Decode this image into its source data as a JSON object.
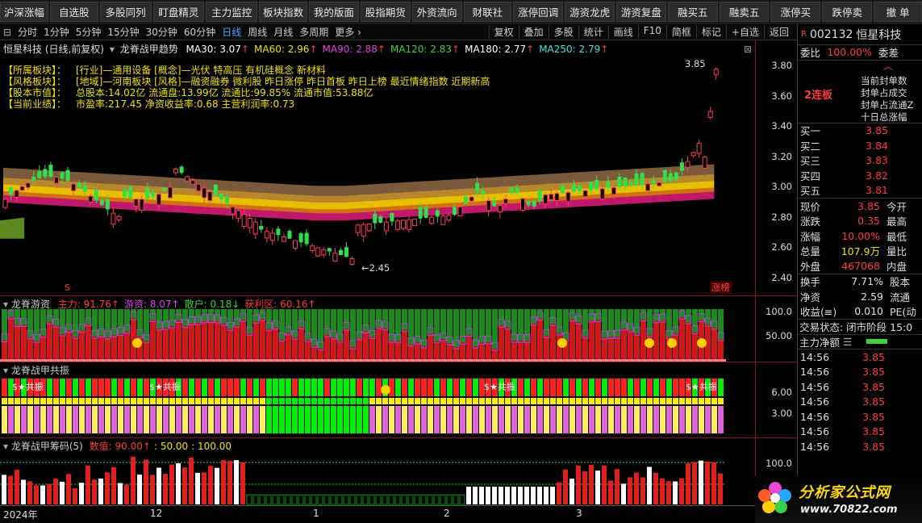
{
  "topbar": {
    "buttons": [
      "沪深涨幅",
      "自选股",
      "多股同列",
      "盯盘精灵",
      "主力监控",
      "板块指数",
      "我的版面",
      "股指期货",
      "外资流向",
      "财联社",
      "涨停回调",
      "游资龙虎",
      "游资复盘",
      "融买五",
      "融卖五",
      "涨停买",
      "跌停卖",
      "撤 单"
    ]
  },
  "periodbar": {
    "items": [
      "分时",
      "1分钟",
      "5分钟",
      "15分钟",
      "30分钟",
      "60分钟",
      "日线",
      "周线",
      "月线",
      "多周期",
      "更多 ›"
    ],
    "active": "日线",
    "right": [
      "复权",
      "叠加",
      "多股",
      "统计",
      "画线",
      "F10",
      "简框",
      "标记",
      "+自选",
      "返回"
    ]
  },
  "main": {
    "title": "恒星科技 (日线,前复权)",
    "indicator": "龙脊战甲趋势",
    "ma": [
      {
        "label": "MA30: 3.07",
        "color": "#ffffff"
      },
      {
        "label": "MA60: 2.96",
        "color": "#f0e000"
      },
      {
        "label": "MA90: 2.88",
        "color": "#e040e0"
      },
      {
        "label": "MA120: 2.83",
        "color": "#3cd23c"
      },
      {
        "label": "MA180: 2.77",
        "color": "#ffffff"
      },
      {
        "label": "MA250: 2.79",
        "color": "#40e0e0"
      }
    ],
    "info": [
      {
        "k": "【所属板块】：",
        "v": "[行业]—通用设备 [概念]—光伏 特高压 有机硅概念 新材料"
      },
      {
        "k": "【风格板块】：",
        "v": "[地域]—河南板块 [风格]—融资融券 微利股 昨日涨停 昨日首板 昨日上榜 最近情绪指数 近期新高"
      },
      {
        "k": "【股本市值】：",
        "v": "总股本:14.02亿 流通盘:13.99亿 流通比:99.85% 流通市值:53.88亿"
      },
      {
        "k": "【当前业绩】：",
        "v": "市盈率:217.45 净资收益率:0.68 主营利润率:0.73"
      }
    ],
    "high_label": "3.85",
    "low_label": "←2.45",
    "badge": "涨榜",
    "axis": [
      "3.80",
      "3.60",
      "3.40",
      "3.20",
      "3.00",
      "2.80",
      "2.60",
      "2.40"
    ]
  },
  "panel1": {
    "title": "龙脊游资",
    "vals": [
      {
        "label": "主力: 91.76↑",
        "color": "#ff3b3b"
      },
      {
        "label": "游资: 8.07↑",
        "color": "#e040e0"
      },
      {
        "label": "散户: 0.18↓",
        "color": "#3cd23c"
      },
      {
        "label": "获利区: 60.16↑",
        "color": "#ff3b3b"
      }
    ],
    "axis": [
      "100.0",
      "50.00"
    ]
  },
  "panel2": {
    "title": "龙脊战甲共振",
    "tag": "共振",
    "axis": [
      "6.00",
      "3.00"
    ]
  },
  "panel3": {
    "title": "龙脊战甲筹码(5)",
    "vals": [
      {
        "label": "数值: 90.00↑",
        "color": "#ff3b3b"
      },
      {
        "label": ": 50.00",
        "color": "#f0e000"
      },
      {
        "label": ": 100.00",
        "color": "#f0e000"
      }
    ],
    "axis": [
      "100.0"
    ]
  },
  "dates": [
    "2024年",
    "12",
    "1",
    "2",
    "3"
  ],
  "right": {
    "code": "002132",
    "name": "恒星科技",
    "weibi_label": "委比",
    "weibi": "100.00%",
    "weicha": "委差",
    "streak": "2连板",
    "tags": [
      "当前封单数",
      "封单占成交",
      "封单占流通Z",
      "十日总涨幅"
    ],
    "buys": [
      {
        "l": "买一",
        "v": "3.85"
      },
      {
        "l": "买二",
        "v": "3.84"
      },
      {
        "l": "买三",
        "v": "3.83"
      },
      {
        "l": "买四",
        "v": "3.82"
      },
      {
        "l": "买五",
        "v": "3.81"
      }
    ],
    "stats": [
      {
        "l": "现价",
        "v": "3.85",
        "c": "#ff3b3b",
        "l2": "今开"
      },
      {
        "l": "涨跌",
        "v": "0.35",
        "c": "#ff3b3b",
        "l2": "最高"
      },
      {
        "l": "涨幅",
        "v": "10.00%",
        "c": "#ff3b3b",
        "l2": "最低"
      },
      {
        "l": "总量",
        "v": "107.9万",
        "c": "#f0e000",
        "l2": "量比"
      },
      {
        "l": "外盘",
        "v": "467068",
        "c": "#ff3b3b",
        "l2": "内盘"
      }
    ],
    "stats2": [
      {
        "l": "换手",
        "v": "7.71%",
        "c": "#e0e0e0",
        "l2": "股本"
      },
      {
        "l": "净资",
        "v": "2.59",
        "c": "#e0e0e0",
        "l2": "流通"
      },
      {
        "l": "收益(≡)",
        "v": "0.010",
        "c": "#e0e0e0",
        "l2": "PE(动"
      }
    ],
    "trade_state": "交易状态: 闭市阶段 15:0",
    "netflow": "主力净额",
    "ticks": [
      {
        "t": "14:56",
        "p": "3.85"
      },
      {
        "t": "14:56",
        "p": "3.85"
      },
      {
        "t": "14:56",
        "p": "3.85"
      },
      {
        "t": "14:56",
        "p": "3.85"
      },
      {
        "t": "14:56",
        "p": "3.85"
      },
      {
        "t": "14:56",
        "p": "3.85"
      },
      {
        "t": "14:56",
        "p": "3.85"
      }
    ]
  },
  "watermark": {
    "text": "分析家公式网",
    "url": "www.70822.com"
  }
}
